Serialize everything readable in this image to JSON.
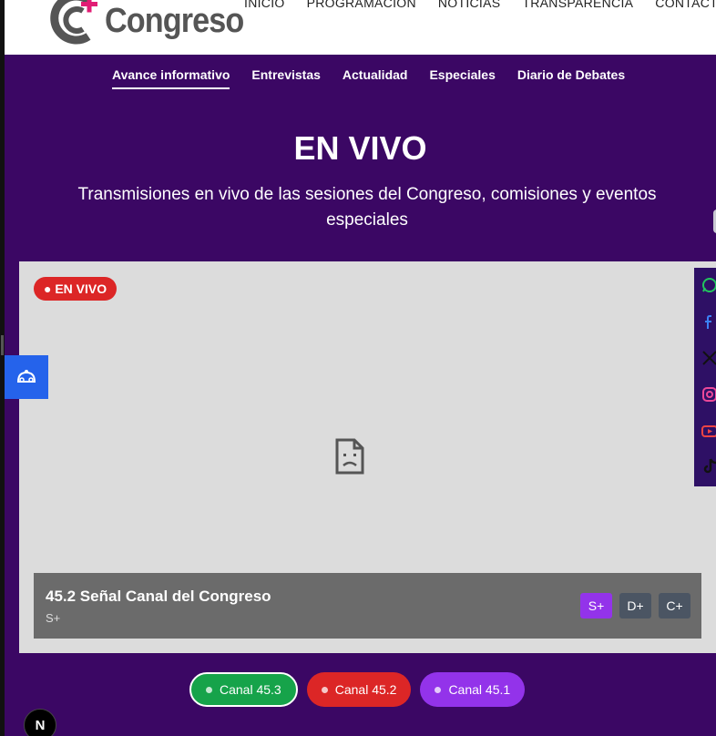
{
  "header": {
    "logo_text": "Congreso",
    "nav": [
      "INICIO",
      "PROGRAMACIÓN",
      "NOTICIAS",
      "TRANSPARENCIA",
      "CONTACTO"
    ]
  },
  "subnav": {
    "items": [
      "Avance informativo",
      "Entrevistas",
      "Actualidad",
      "Especiales",
      "Diario de Debates"
    ],
    "active_index": 0
  },
  "hero": {
    "title": "EN VIVO",
    "subtitle": "Transmisiones en vivo de las sesiones del Congreso, comisiones y eventos especiales"
  },
  "player": {
    "live_badge": "● EN VIVO",
    "channel_name": "45.2 Señal Canal del Congreso",
    "channel_code": "S+",
    "quality_options": [
      "S+",
      "D+",
      "C+"
    ],
    "quality_selected": "S+"
  },
  "channels": [
    {
      "label": "Canal 45.3",
      "color": "#16a34a"
    },
    {
      "label": "Canal 45.2",
      "color": "#dc2626"
    },
    {
      "label": "Canal 45.1",
      "color": "#9333ea"
    }
  ],
  "social_icons": [
    "whatsapp-icon",
    "facebook-icon",
    "x-icon",
    "instagram-icon",
    "youtube-icon",
    "tiktok-icon"
  ],
  "next_badge": "N",
  "colors": {
    "hero_bg": "#3b0764",
    "live_red": "#dc2626",
    "accent_purple": "#9333ea",
    "accessibility_blue": "#2563eb"
  }
}
